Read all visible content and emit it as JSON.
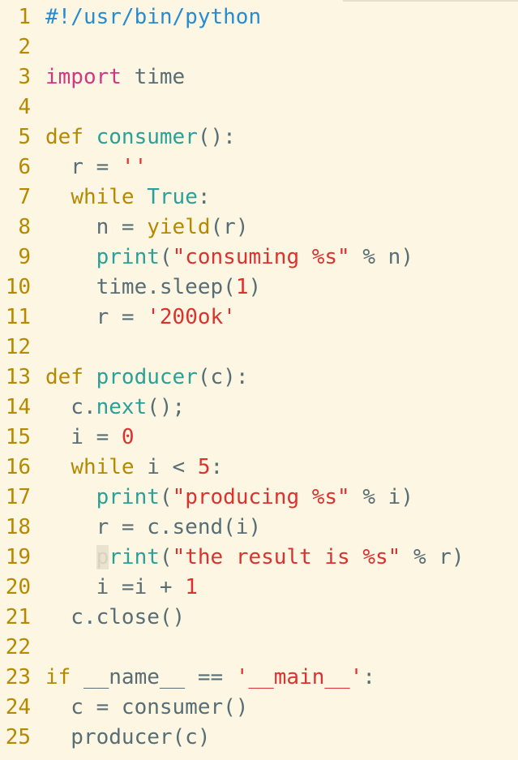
{
  "editor": {
    "lines": [
      {
        "n": "1",
        "tokens": [
          {
            "t": "#!/usr/bin/python",
            "c": "cmt"
          }
        ]
      },
      {
        "n": "2",
        "tokens": []
      },
      {
        "n": "3",
        "tokens": [
          {
            "t": "import",
            "c": "imp"
          },
          {
            "t": " time",
            "c": "txt"
          }
        ]
      },
      {
        "n": "4",
        "tokens": []
      },
      {
        "n": "5",
        "tokens": [
          {
            "t": "def",
            "c": "kw"
          },
          {
            "t": " ",
            "c": "txt"
          },
          {
            "t": "consumer",
            "c": "fn"
          },
          {
            "t": "():",
            "c": "op"
          }
        ]
      },
      {
        "n": "6",
        "tokens": [
          {
            "t": "  r = ",
            "c": "txt"
          },
          {
            "t": "''",
            "c": "str"
          }
        ]
      },
      {
        "n": "7",
        "tokens": [
          {
            "t": "  ",
            "c": "txt"
          },
          {
            "t": "while",
            "c": "kw"
          },
          {
            "t": " ",
            "c": "txt"
          },
          {
            "t": "True",
            "c": "fn"
          },
          {
            "t": ":",
            "c": "op"
          }
        ]
      },
      {
        "n": "8",
        "tokens": [
          {
            "t": "    n = ",
            "c": "txt"
          },
          {
            "t": "yield",
            "c": "kw"
          },
          {
            "t": "(r)",
            "c": "op"
          }
        ]
      },
      {
        "n": "9",
        "tokens": [
          {
            "t": "    ",
            "c": "txt"
          },
          {
            "t": "print",
            "c": "fn"
          },
          {
            "t": "(",
            "c": "op"
          },
          {
            "t": "\"consuming %s\"",
            "c": "str"
          },
          {
            "t": " % n)",
            "c": "op"
          }
        ]
      },
      {
        "n": "10",
        "tokens": [
          {
            "t": "    time.sleep(",
            "c": "txt"
          },
          {
            "t": "1",
            "c": "num"
          },
          {
            "t": ")",
            "c": "op"
          }
        ]
      },
      {
        "n": "11",
        "tokens": [
          {
            "t": "    r = ",
            "c": "txt"
          },
          {
            "t": "'200ok'",
            "c": "str"
          }
        ]
      },
      {
        "n": "12",
        "tokens": []
      },
      {
        "n": "13",
        "tokens": [
          {
            "t": "def",
            "c": "kw"
          },
          {
            "t": " ",
            "c": "txt"
          },
          {
            "t": "producer",
            "c": "fn"
          },
          {
            "t": "(c):",
            "c": "op"
          }
        ]
      },
      {
        "n": "14",
        "tokens": [
          {
            "t": "  c.",
            "c": "txt"
          },
          {
            "t": "next",
            "c": "fn"
          },
          {
            "t": "();",
            "c": "op"
          }
        ]
      },
      {
        "n": "15",
        "tokens": [
          {
            "t": "  i = ",
            "c": "txt"
          },
          {
            "t": "0",
            "c": "num"
          }
        ]
      },
      {
        "n": "16",
        "tokens": [
          {
            "t": "  ",
            "c": "txt"
          },
          {
            "t": "while",
            "c": "kw"
          },
          {
            "t": " i < ",
            "c": "txt"
          },
          {
            "t": "5",
            "c": "num"
          },
          {
            "t": ":",
            "c": "op"
          }
        ]
      },
      {
        "n": "17",
        "tokens": [
          {
            "t": "    ",
            "c": "txt"
          },
          {
            "t": "print",
            "c": "fn"
          },
          {
            "t": "(",
            "c": "op"
          },
          {
            "t": "\"producing %s\"",
            "c": "str"
          },
          {
            "t": " % i)",
            "c": "op"
          }
        ]
      },
      {
        "n": "18",
        "tokens": [
          {
            "t": "    r = c.send(i)",
            "c": "txt"
          }
        ]
      },
      {
        "n": "19",
        "tokens": [
          {
            "t": "    ",
            "c": "txt"
          },
          {
            "t": "p",
            "c": "cursor"
          },
          {
            "t": "rint",
            "c": "fn"
          },
          {
            "t": "(",
            "c": "op"
          },
          {
            "t": "\"the result is %s\"",
            "c": "str"
          },
          {
            "t": " % r)",
            "c": "op"
          }
        ]
      },
      {
        "n": "20",
        "tokens": [
          {
            "t": "    i =i + ",
            "c": "txt"
          },
          {
            "t": "1",
            "c": "num"
          }
        ]
      },
      {
        "n": "21",
        "tokens": [
          {
            "t": "  c.close()",
            "c": "txt"
          }
        ]
      },
      {
        "n": "22",
        "tokens": []
      },
      {
        "n": "23",
        "tokens": [
          {
            "t": "if",
            "c": "kw"
          },
          {
            "t": " __name__ == ",
            "c": "txt"
          },
          {
            "t": "'__main__'",
            "c": "str"
          },
          {
            "t": ":",
            "c": "op"
          }
        ]
      },
      {
        "n": "24",
        "tokens": [
          {
            "t": "  c = consumer()",
            "c": "txt"
          }
        ]
      },
      {
        "n": "25",
        "tokens": [
          {
            "t": "  producer(c)",
            "c": "txt"
          }
        ]
      }
    ]
  }
}
